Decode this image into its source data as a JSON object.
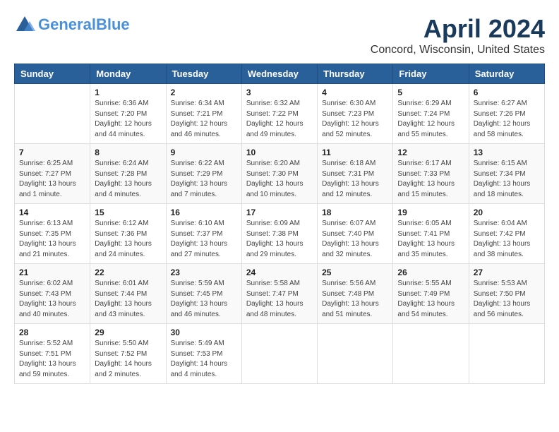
{
  "header": {
    "logo_line1": "General",
    "logo_line2": "Blue",
    "month": "April 2024",
    "location": "Concord, Wisconsin, United States"
  },
  "weekdays": [
    "Sunday",
    "Monday",
    "Tuesday",
    "Wednesday",
    "Thursday",
    "Friday",
    "Saturday"
  ],
  "weeks": [
    [
      {
        "day": "",
        "info": ""
      },
      {
        "day": "1",
        "info": "Sunrise: 6:36 AM\nSunset: 7:20 PM\nDaylight: 12 hours\nand 44 minutes."
      },
      {
        "day": "2",
        "info": "Sunrise: 6:34 AM\nSunset: 7:21 PM\nDaylight: 12 hours\nand 46 minutes."
      },
      {
        "day": "3",
        "info": "Sunrise: 6:32 AM\nSunset: 7:22 PM\nDaylight: 12 hours\nand 49 minutes."
      },
      {
        "day": "4",
        "info": "Sunrise: 6:30 AM\nSunset: 7:23 PM\nDaylight: 12 hours\nand 52 minutes."
      },
      {
        "day": "5",
        "info": "Sunrise: 6:29 AM\nSunset: 7:24 PM\nDaylight: 12 hours\nand 55 minutes."
      },
      {
        "day": "6",
        "info": "Sunrise: 6:27 AM\nSunset: 7:26 PM\nDaylight: 12 hours\nand 58 minutes."
      }
    ],
    [
      {
        "day": "7",
        "info": "Sunrise: 6:25 AM\nSunset: 7:27 PM\nDaylight: 13 hours\nand 1 minute."
      },
      {
        "day": "8",
        "info": "Sunrise: 6:24 AM\nSunset: 7:28 PM\nDaylight: 13 hours\nand 4 minutes."
      },
      {
        "day": "9",
        "info": "Sunrise: 6:22 AM\nSunset: 7:29 PM\nDaylight: 13 hours\nand 7 minutes."
      },
      {
        "day": "10",
        "info": "Sunrise: 6:20 AM\nSunset: 7:30 PM\nDaylight: 13 hours\nand 10 minutes."
      },
      {
        "day": "11",
        "info": "Sunrise: 6:18 AM\nSunset: 7:31 PM\nDaylight: 13 hours\nand 12 minutes."
      },
      {
        "day": "12",
        "info": "Sunrise: 6:17 AM\nSunset: 7:33 PM\nDaylight: 13 hours\nand 15 minutes."
      },
      {
        "day": "13",
        "info": "Sunrise: 6:15 AM\nSunset: 7:34 PM\nDaylight: 13 hours\nand 18 minutes."
      }
    ],
    [
      {
        "day": "14",
        "info": "Sunrise: 6:13 AM\nSunset: 7:35 PM\nDaylight: 13 hours\nand 21 minutes."
      },
      {
        "day": "15",
        "info": "Sunrise: 6:12 AM\nSunset: 7:36 PM\nDaylight: 13 hours\nand 24 minutes."
      },
      {
        "day": "16",
        "info": "Sunrise: 6:10 AM\nSunset: 7:37 PM\nDaylight: 13 hours\nand 27 minutes."
      },
      {
        "day": "17",
        "info": "Sunrise: 6:09 AM\nSunset: 7:38 PM\nDaylight: 13 hours\nand 29 minutes."
      },
      {
        "day": "18",
        "info": "Sunrise: 6:07 AM\nSunset: 7:40 PM\nDaylight: 13 hours\nand 32 minutes."
      },
      {
        "day": "19",
        "info": "Sunrise: 6:05 AM\nSunset: 7:41 PM\nDaylight: 13 hours\nand 35 minutes."
      },
      {
        "day": "20",
        "info": "Sunrise: 6:04 AM\nSunset: 7:42 PM\nDaylight: 13 hours\nand 38 minutes."
      }
    ],
    [
      {
        "day": "21",
        "info": "Sunrise: 6:02 AM\nSunset: 7:43 PM\nDaylight: 13 hours\nand 40 minutes."
      },
      {
        "day": "22",
        "info": "Sunrise: 6:01 AM\nSunset: 7:44 PM\nDaylight: 13 hours\nand 43 minutes."
      },
      {
        "day": "23",
        "info": "Sunrise: 5:59 AM\nSunset: 7:45 PM\nDaylight: 13 hours\nand 46 minutes."
      },
      {
        "day": "24",
        "info": "Sunrise: 5:58 AM\nSunset: 7:47 PM\nDaylight: 13 hours\nand 48 minutes."
      },
      {
        "day": "25",
        "info": "Sunrise: 5:56 AM\nSunset: 7:48 PM\nDaylight: 13 hours\nand 51 minutes."
      },
      {
        "day": "26",
        "info": "Sunrise: 5:55 AM\nSunset: 7:49 PM\nDaylight: 13 hours\nand 54 minutes."
      },
      {
        "day": "27",
        "info": "Sunrise: 5:53 AM\nSunset: 7:50 PM\nDaylight: 13 hours\nand 56 minutes."
      }
    ],
    [
      {
        "day": "28",
        "info": "Sunrise: 5:52 AM\nSunset: 7:51 PM\nDaylight: 13 hours\nand 59 minutes."
      },
      {
        "day": "29",
        "info": "Sunrise: 5:50 AM\nSunset: 7:52 PM\nDaylight: 14 hours\nand 2 minutes."
      },
      {
        "day": "30",
        "info": "Sunrise: 5:49 AM\nSunset: 7:53 PM\nDaylight: 14 hours\nand 4 minutes."
      },
      {
        "day": "",
        "info": ""
      },
      {
        "day": "",
        "info": ""
      },
      {
        "day": "",
        "info": ""
      },
      {
        "day": "",
        "info": ""
      }
    ]
  ]
}
